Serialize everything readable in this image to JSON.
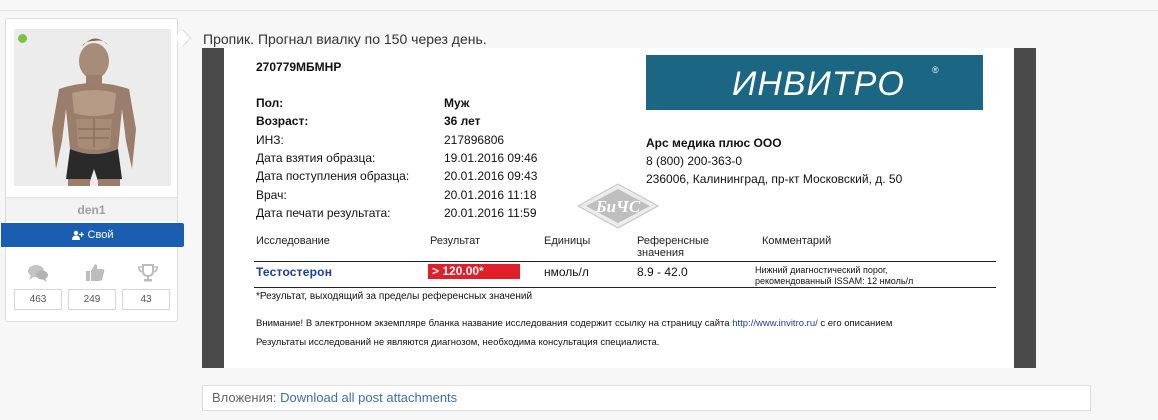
{
  "user": {
    "username": "den1",
    "role_label": "Свой",
    "stats": [
      {
        "icon": "comments-icon",
        "value": "463"
      },
      {
        "icon": "thumbs-up-icon",
        "value": "249"
      },
      {
        "icon": "trophy-icon",
        "value": "43"
      }
    ],
    "online_color": "#7fc241"
  },
  "post": {
    "text": "Пропик. Прогнал виалку по 150 через день."
  },
  "document": {
    "id": "270779МБМНР",
    "logo_text": "ИНВИТРО",
    "logo_mark": "®",
    "patient": [
      {
        "label": "Пол:",
        "value": "Муж",
        "bold": true
      },
      {
        "label": "Возраст:",
        "value": "36 лет",
        "bold": true
      },
      {
        "label": "ИНЗ:",
        "value": "217896806",
        "bold": false
      },
      {
        "label": "Дата взятия образца:",
        "value": "19.01.2016 09:46",
        "bold": false
      },
      {
        "label": "Дата поступления образца:",
        "value": "20.01.2016 09:43",
        "bold": false
      },
      {
        "label": "Врач:",
        "value": "20.01.2016 11:18",
        "bold": false
      },
      {
        "label": "Дата печати результата:",
        "value": "20.01.2016 11:59",
        "bold": false
      }
    ],
    "lab": {
      "name": "Арс медика плюс ООО",
      "phone": "8 (800) 200-363-0",
      "address": "236006, Калининград, пр-кт Московский, д. 50"
    },
    "watermark_text": "БиЧС",
    "table": {
      "headers": {
        "test": "Исследование",
        "result": "Результат",
        "units": "Единицы",
        "reference_line1": "Референсные",
        "reference_line2": "значения",
        "comment": "Комментарий"
      },
      "row": {
        "test": "Тестостерон",
        "result": "> 120.00*",
        "units": "нмоль/л",
        "reference": "8.9 - 42.0",
        "comment_line1": "Нижний диагностический порог,",
        "comment_line2": "рекомендованный ISSAM: 12 нмоль/л"
      }
    },
    "footnote": "*Результат, выходящий за пределы референсных значений",
    "notice1_before": "Внимание! В электронном экземпляре бланка название исследования содержит ссылку на страницу сайта ",
    "notice1_link": "http://www.invitro.ru/",
    "notice1_after": " с его описанием",
    "notice2": "Результаты исследований не являются диагнозом, необходима консультация специалиста."
  },
  "attachments": {
    "label": "Вложения: ",
    "link": "Download all post attachments"
  },
  "colors": {
    "badge_blue": "#1b5db1",
    "logo_teal": "#1b6683",
    "result_red": "#e21e2b",
    "link_blue": "#3a6fb0"
  }
}
